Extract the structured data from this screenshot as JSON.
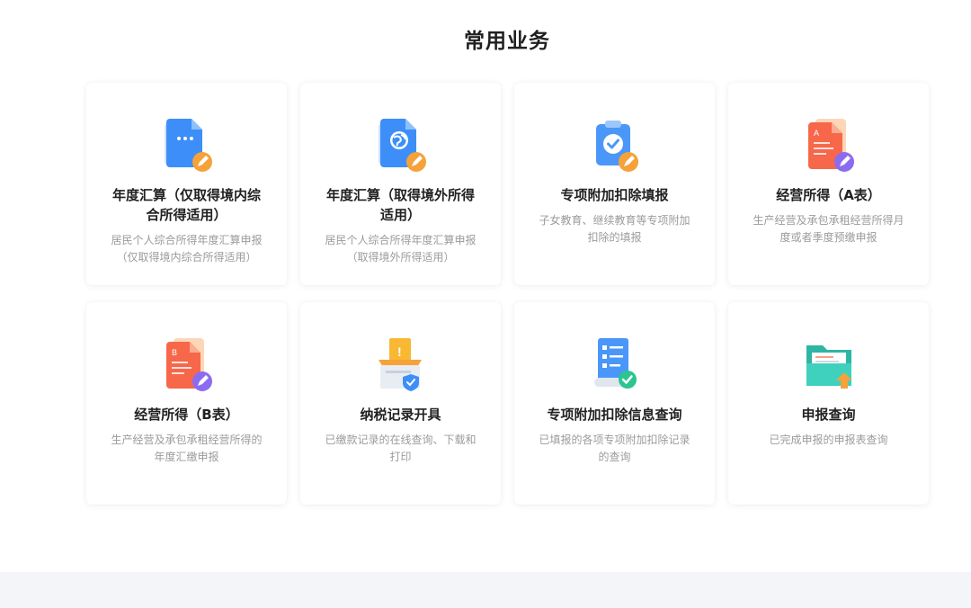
{
  "section": {
    "title": "常用业务"
  },
  "cards": [
    {
      "title": "年度汇算（仅取得境内综合所得适用）",
      "desc": "居民个人综合所得年度汇算申报（仅取得境内综合所得适用）",
      "icon": "document-chat-icon"
    },
    {
      "title": "年度汇算（取得境外所得适用）",
      "desc": "居民个人综合所得年度汇算申报（取得境外所得适用）",
      "icon": "document-globe-icon"
    },
    {
      "title": "专项附加扣除填报",
      "desc": "子女教育、继续教育等专项附加扣除的填报",
      "icon": "clipboard-check-icon"
    },
    {
      "title": "经营所得（A表）",
      "desc": "生产经营及承包承租经营所得月度或者季度预缴申报",
      "icon": "form-a-icon"
    },
    {
      "title": "经营所得（B表）",
      "desc": "生产经营及承包承租经营所得的年度汇缴申报",
      "icon": "form-b-icon"
    },
    {
      "title": "纳税记录开具",
      "desc": "已缴款记录的在线查询、下载和打印",
      "icon": "tax-record-box-icon"
    },
    {
      "title": "专项附加扣除信息查询",
      "desc": "已填报的各项专项附加扣除记录的查询",
      "icon": "checklist-scroll-icon"
    },
    {
      "title": "申报查询",
      "desc": "已完成申报的申报表查询",
      "icon": "folder-upload-icon"
    }
  ],
  "colors": {
    "title": "#222222",
    "desc": "#9b9b9b",
    "blue": "#3d8ef8",
    "orange": "#f5a23a",
    "red": "#f7674a",
    "purple": "#8b6cf0",
    "green": "#2bc58e",
    "teal": "#31c7b4"
  }
}
